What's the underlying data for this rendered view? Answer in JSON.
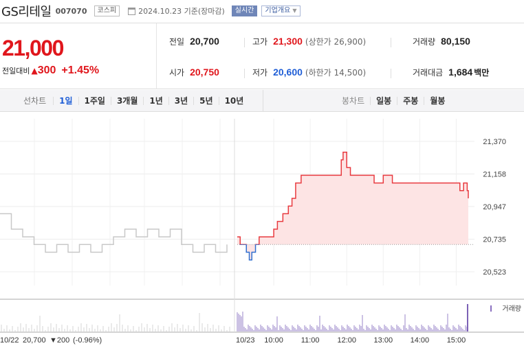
{
  "header": {
    "stock_name": "GS리테일",
    "stock_code": "007070",
    "market": "코스피",
    "date_text": "2024.10.23 기준(장마감)",
    "live_label": "실시간",
    "company_info_label": "기업개요"
  },
  "quote": {
    "price": "21,000",
    "change_label": "전일대비",
    "change_arrow": "▲",
    "change_value": "300",
    "change_pct": "+1.45%",
    "prev_close_label": "전일",
    "prev_close": "20,700",
    "high_label": "고가",
    "high": "21,300",
    "upper_limit": "(상한가 26,900)",
    "volume_label": "거래량",
    "volume": "80,150",
    "open_label": "시가",
    "open": "20,750",
    "low_label": "저가",
    "low": "20,600",
    "lower_limit": "(하한가 14,500)",
    "amount_label": "거래대금",
    "amount": "1,684",
    "amount_unit": "백만"
  },
  "period_bar": {
    "label": "선차트",
    "periods": [
      "1일",
      "1주일",
      "3개월",
      "1년",
      "3년",
      "5년",
      "10년"
    ],
    "active": "1일",
    "candle_label": "봉차트",
    "candle_periods": [
      "일봉",
      "주봉",
      "월봉"
    ]
  },
  "chart_data": {
    "type": "line",
    "y_ticks": [
      "21,370",
      "21,158",
      "20,947",
      "20,735",
      "20,523"
    ],
    "ylim": [
      20523,
      21370
    ],
    "reference_price": 20700,
    "prev_day": {
      "date_label": "10/22",
      "close": "20,700",
      "change": "▼200",
      "change_pct": "(-0.96%)",
      "x": [
        0,
        0.05,
        0.1,
        0.15,
        0.2,
        0.25,
        0.3,
        0.35,
        0.4,
        0.45,
        0.5,
        0.55,
        0.6,
        0.65,
        0.7,
        0.75,
        0.8,
        0.85,
        0.9,
        0.95,
        1
      ],
      "y": [
        20900,
        20800,
        20750,
        20700,
        20650,
        20700,
        20650,
        20700,
        20650,
        20700,
        20750,
        20800,
        20750,
        20800,
        20750,
        20800,
        20700,
        20650,
        20700,
        20650,
        20700
      ]
    },
    "today": {
      "date_label": "10/23",
      "x_ticks": [
        "10:00",
        "11:00",
        "12:00",
        "13:00",
        "14:00",
        "15:00"
      ],
      "t": [
        9.0,
        9.08,
        9.17,
        9.25,
        9.33,
        9.4,
        9.5,
        9.6,
        9.75,
        9.9,
        10.0,
        10.1,
        10.25,
        10.4,
        10.5,
        10.6,
        10.75,
        10.9,
        11.0,
        11.25,
        11.5,
        11.75,
        11.85,
        11.9,
        12.0,
        12.1,
        12.25,
        12.5,
        12.75,
        13.0,
        13.25,
        13.5,
        13.75,
        14.0,
        14.25,
        14.5,
        14.75,
        15.0,
        15.1,
        15.2,
        15.3,
        15.33
      ],
      "price": [
        20750,
        20700,
        20700,
        20650,
        20600,
        20650,
        20700,
        20750,
        20750,
        20750,
        20800,
        20850,
        20900,
        20950,
        21000,
        21100,
        21150,
        21150,
        21150,
        21150,
        21150,
        21150,
        21250,
        21300,
        21200,
        21150,
        21150,
        21150,
        21100,
        21150,
        21100,
        21100,
        21100,
        21100,
        21100,
        21100,
        21100,
        21100,
        21050,
        21100,
        21050,
        21000
      ]
    },
    "volume_label": "거래량"
  }
}
